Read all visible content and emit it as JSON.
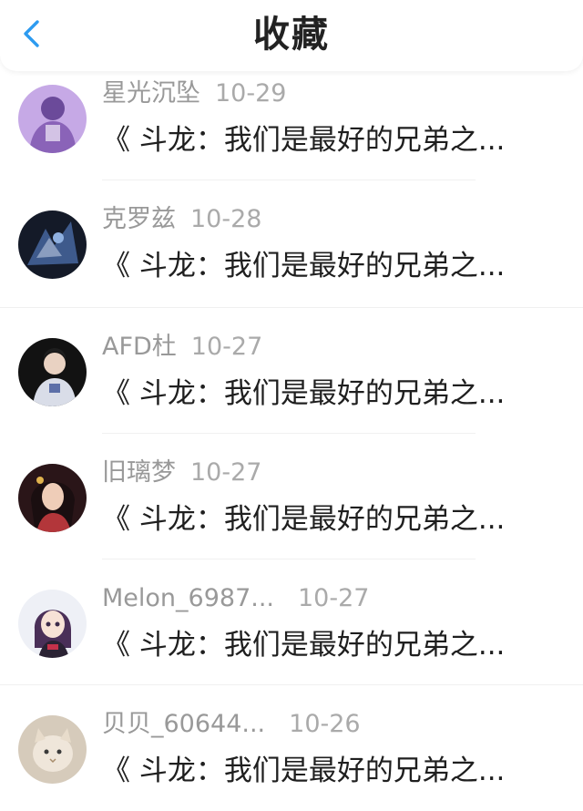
{
  "header": {
    "title": "收藏",
    "back_icon": "chevron-left-icon",
    "accent_color": "#2d9bf0"
  },
  "items": [
    {
      "username": "星光沉坠",
      "date": "10-29",
      "text": "《 斗龙：我们是最好的兄弟之...",
      "avatar": {
        "bg": "#b497d6",
        "fg": "#6b4a9a"
      }
    },
    {
      "username": "克罗兹",
      "date": "10-28",
      "text": "《 斗龙：我们是最好的兄弟之...",
      "avatar": {
        "bg": "#1c2233",
        "fg": "#5a6f9a"
      }
    },
    {
      "username": "AFD杜",
      "date": "10-27",
      "text": "《 斗龙：我们是最好的兄弟之...",
      "avatar": {
        "bg": "#141414",
        "fg": "#d8dbe4"
      }
    },
    {
      "username": "旧璃梦",
      "date": "10-27",
      "text": "《 斗龙：我们是最好的兄弟之...",
      "avatar": {
        "bg": "#3a1f22",
        "fg": "#d8a28a"
      }
    },
    {
      "username": "Melon_6987...",
      "date": "10-27",
      "text": "《 斗龙：我们是最好的兄弟之...",
      "avatar": {
        "bg": "#eef0f6",
        "fg": "#4a2f58"
      }
    },
    {
      "username": "贝贝_60644...",
      "date": "10-26",
      "text": "《 斗龙：我们是最好的兄弟之...",
      "avatar": {
        "bg": "#d8cdbd",
        "fg": "#a88d6c"
      }
    }
  ]
}
